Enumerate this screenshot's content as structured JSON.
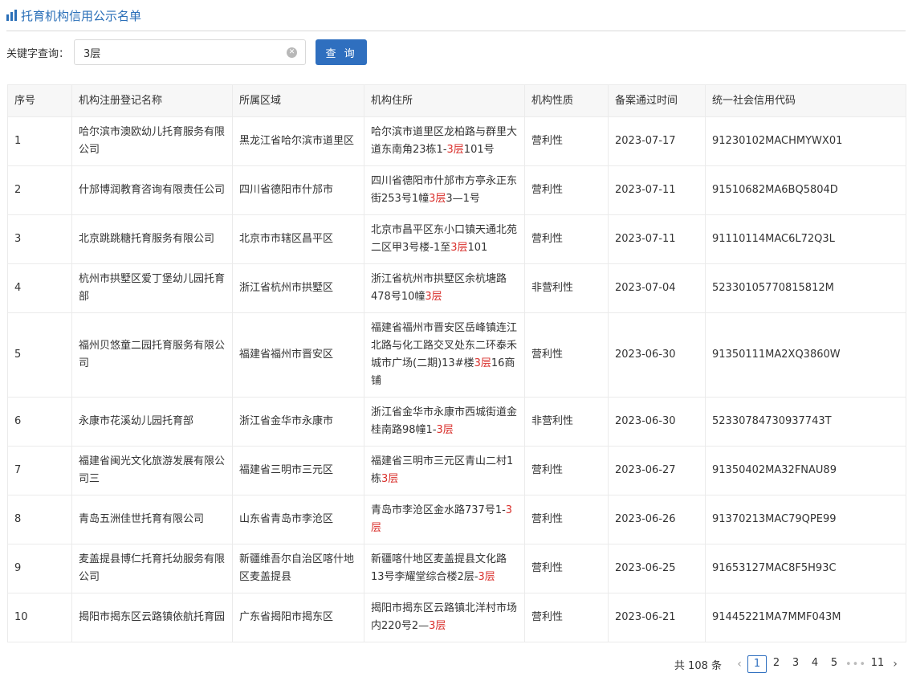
{
  "header": {
    "title": "托育机构信用公示名单",
    "icon": "list-bars-icon",
    "accent": "#2a6fb8"
  },
  "search": {
    "label": "关键字查询：",
    "value": "3层",
    "button": "查 询"
  },
  "table": {
    "columns": [
      "序号",
      "机构注册登记名称",
      "所属区域",
      "机构住所",
      "机构性质",
      "备案通过时间",
      "统一社会信用代码"
    ],
    "rows": [
      {
        "no": "1",
        "name": "哈尔滨市澳欧幼儿托育服务有限公司",
        "region": "黑龙江省哈尔滨市道里区",
        "addr_pre": "哈尔滨市道里区龙柏路与群里大道东南角23栋1-",
        "addr_hl": "3层",
        "addr_post": "101号",
        "type": "营利性",
        "date": "2023-07-17",
        "code": "91230102MACHMYWX01"
      },
      {
        "no": "2",
        "name": "什邡博润教育咨询有限责任公司",
        "region": "四川省德阳市什邡市",
        "addr_pre": "四川省德阳市什邡市方亭永正东街253号1幢",
        "addr_hl": "3层",
        "addr_post": "3—1号",
        "type": "营利性",
        "date": "2023-07-11",
        "code": "91510682MA6BQ5804D"
      },
      {
        "no": "3",
        "name": "北京跳跳糖托育服务有限公司",
        "region": "北京市市辖区昌平区",
        "addr_pre": "北京市昌平区东小口镇天通北苑二区甲3号楼-1至",
        "addr_hl": "3层",
        "addr_post": "101",
        "type": "营利性",
        "date": "2023-07-11",
        "code": "91110114MAC6L72Q3L"
      },
      {
        "no": "4",
        "name": "杭州市拱墅区爱丁堡幼儿园托育部",
        "region": "浙江省杭州市拱墅区",
        "addr_pre": "浙江省杭州市拱墅区余杭塘路478号10幢",
        "addr_hl": "3层",
        "addr_post": "",
        "type": "非营利性",
        "date": "2023-07-04",
        "code": "52330105770815812M"
      },
      {
        "no": "5",
        "name": "福州贝悠童二园托育服务有限公司",
        "region": "福建省福州市晋安区",
        "addr_pre": "福建省福州市晋安区岳峰镇连江北路与化工路交叉处东二环泰禾城市广场(二期)13#楼",
        "addr_hl": "3层",
        "addr_post": "16商铺",
        "type": "营利性",
        "date": "2023-06-30",
        "code": "91350111MA2XQ3860W"
      },
      {
        "no": "6",
        "name": "永康市花溪幼儿园托育部",
        "region": "浙江省金华市永康市",
        "addr_pre": "浙江省金华市永康市西城街道金桂南路98幢1-",
        "addr_hl": "3层",
        "addr_post": "",
        "type": "非营利性",
        "date": "2023-06-30",
        "code": "52330784730937743T"
      },
      {
        "no": "7",
        "name": "福建省闽光文化旅游发展有限公司三",
        "region": "福建省三明市三元区",
        "addr_pre": "福建省三明市三元区青山二村1栋",
        "addr_hl": "3层",
        "addr_post": "",
        "type": "营利性",
        "date": "2023-06-27",
        "code": "91350402MA32FNAU89"
      },
      {
        "no": "8",
        "name": "青岛五洲佳世托育有限公司",
        "region": "山东省青岛市李沧区",
        "addr_pre": "青岛市李沧区金水路737号1-",
        "addr_hl": "3层",
        "addr_post": "",
        "type": "营利性",
        "date": "2023-06-26",
        "code": "91370213MAC79QPE99"
      },
      {
        "no": "9",
        "name": "麦盖提县博仁托育托幼服务有限公司",
        "region": "新疆维吾尔自治区喀什地区麦盖提县",
        "addr_pre": "新疆喀什地区麦盖提县文化路13号李耀堂综合楼2层-",
        "addr_hl": "3层",
        "addr_post": "",
        "type": "营利性",
        "date": "2023-06-25",
        "code": "91653127MAC8F5H93C"
      },
      {
        "no": "10",
        "name": "揭阳市揭东区云路镇依航托育园",
        "region": "广东省揭阳市揭东区",
        "addr_pre": "揭阳市揭东区云路镇北洋村市场内220号2—",
        "addr_hl": "3层",
        "addr_post": "",
        "type": "营利性",
        "date": "2023-06-21",
        "code": "91445221MA7MMF043M"
      }
    ]
  },
  "pagination": {
    "total": "共 108 条",
    "prev": "‹",
    "next": "›",
    "pages": [
      "1",
      "2",
      "3",
      "4",
      "5"
    ],
    "dots": "•••",
    "last": "11",
    "current": "1"
  }
}
